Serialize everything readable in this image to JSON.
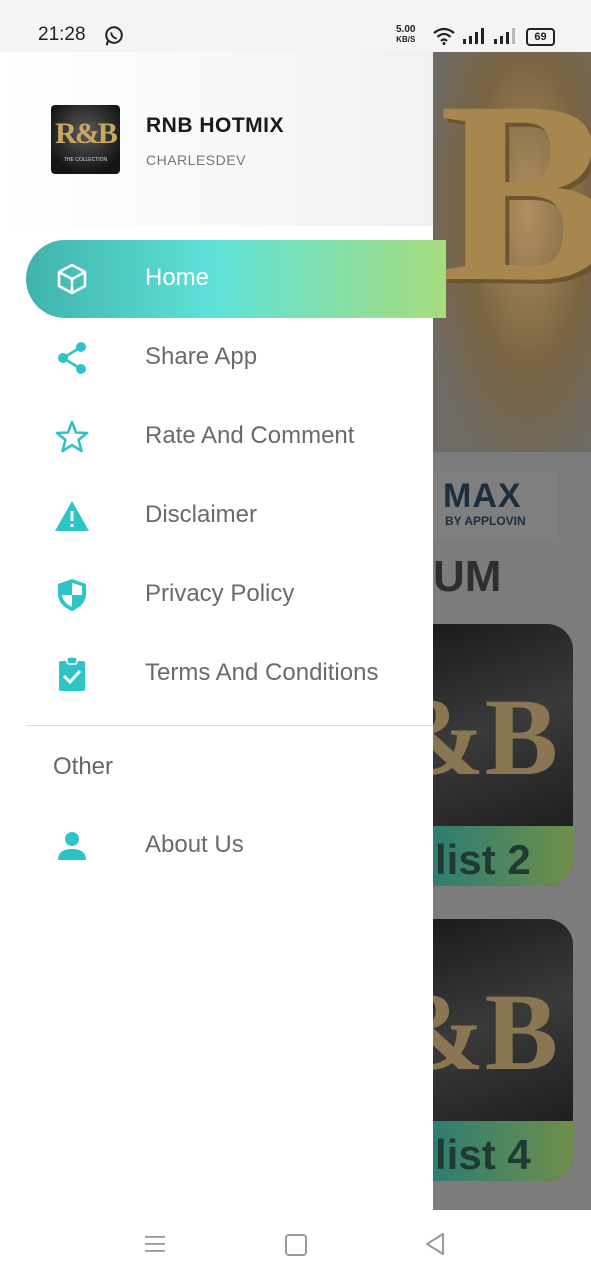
{
  "status_bar": {
    "time": "21:28",
    "net_speed_value": "5.00",
    "net_speed_unit": "KB/S",
    "battery": "69"
  },
  "drawer": {
    "app_title": "RNB HOTMIX",
    "developer": "CHARLESDEV",
    "logo_text": "R&B",
    "logo_subtext": "THE COLLECTION",
    "accent_color": "#5ee2d9",
    "items": [
      {
        "label": "Home",
        "icon": "cube-icon",
        "active": true
      },
      {
        "label": "Share App",
        "icon": "share-icon"
      },
      {
        "label": "Rate And Comment",
        "icon": "star-icon"
      },
      {
        "label": "Disclaimer",
        "icon": "warning-icon"
      },
      {
        "label": "Privacy Policy",
        "icon": "shield-icon"
      },
      {
        "label": "Terms And Conditions",
        "icon": "clipboard-check-icon"
      }
    ],
    "other_section": {
      "title": "Other",
      "items": [
        {
          "label": "About Us",
          "icon": "person-icon"
        }
      ]
    }
  },
  "background": {
    "ad_brand": "MAX",
    "ad_by": "BY APPLOVIN",
    "section_fragment": "UM",
    "card1_label": "list 2",
    "card2_label": "list 4"
  }
}
